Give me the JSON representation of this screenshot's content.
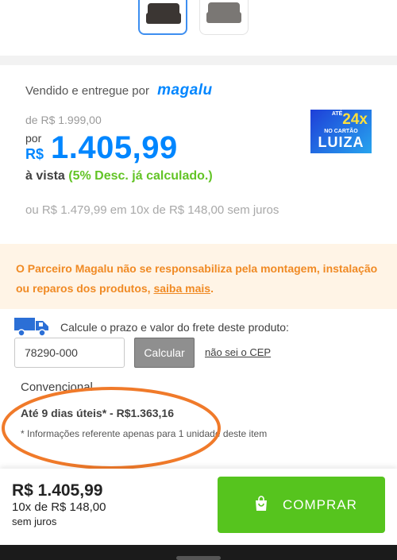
{
  "seller": {
    "prefix": "Vendido e entregue por",
    "brand": "magalu"
  },
  "pricing": {
    "old_price": "de R$ 1.999,00",
    "por_label": "por",
    "currency": "R$",
    "price": "1.405,99",
    "vista_label": "à vista",
    "discount_note": "(5% Desc. já calculado.)",
    "installments": "ou R$ 1.479,99 em 10x de R$ 148,00 sem juros"
  },
  "badge": {
    "ate": "ATÉ",
    "count": "24x",
    "line2": "NO CARTÃO",
    "line3": "LUIZA"
  },
  "warning": {
    "text": "O Parceiro Magalu não se responsabiliza pela montagem, instalação ou reparos dos produtos,",
    "link": "saiba mais",
    "end": "."
  },
  "freight": {
    "label": "Calcule o prazo e valor do frete deste produto:",
    "cep_value": "78290-000",
    "calc_button": "Calcular",
    "no_cep_link": "não sei o CEP"
  },
  "shipping": {
    "title": "Convencional",
    "main": "Até 9 dias úteis* - R$1.363,16",
    "note": "* Informações referente apenas para 1 unidade deste item"
  },
  "bottom_bar": {
    "price": "R$ 1.405,99",
    "installments": "10x de R$ 148,00",
    "juros": "sem juros",
    "buy_button": "COMPRAR"
  },
  "colors": {
    "brand_blue": "#0086ff",
    "discount_green": "#63c426",
    "warning_orange": "#f08a24",
    "buy_green": "#56c41e",
    "annotation_circle": "#f07a2a"
  },
  "icons": {
    "truck": "truck-icon",
    "bag": "shopping-bag-icon"
  }
}
